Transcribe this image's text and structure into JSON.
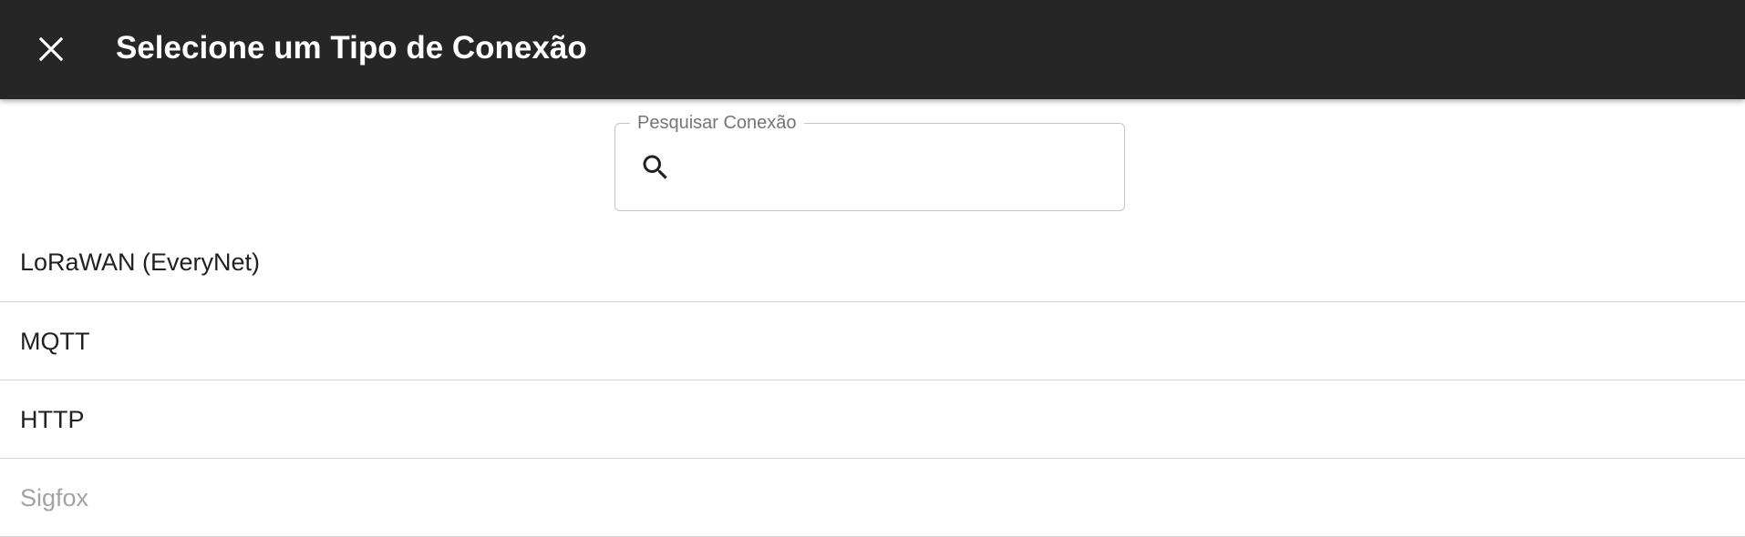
{
  "header": {
    "close_icon": "close-icon",
    "title": "Selecione um Tipo de Conexão"
  },
  "search": {
    "label": "Pesquisar Conexão",
    "icon": "search-icon",
    "value": "",
    "placeholder": ""
  },
  "connections": [
    {
      "label": "LoRaWAN (EveryNet)",
      "disabled": false
    },
    {
      "label": "MQTT",
      "disabled": false
    },
    {
      "label": "HTTP",
      "disabled": false
    },
    {
      "label": "Sigfox",
      "disabled": true
    }
  ],
  "colors": {
    "topbar": "#262626",
    "title": "#ffffff",
    "text": "#212121",
    "disabled_text": "#a3a3a3",
    "divider": "#d4d4d4",
    "outline": "#c4c4c4"
  }
}
